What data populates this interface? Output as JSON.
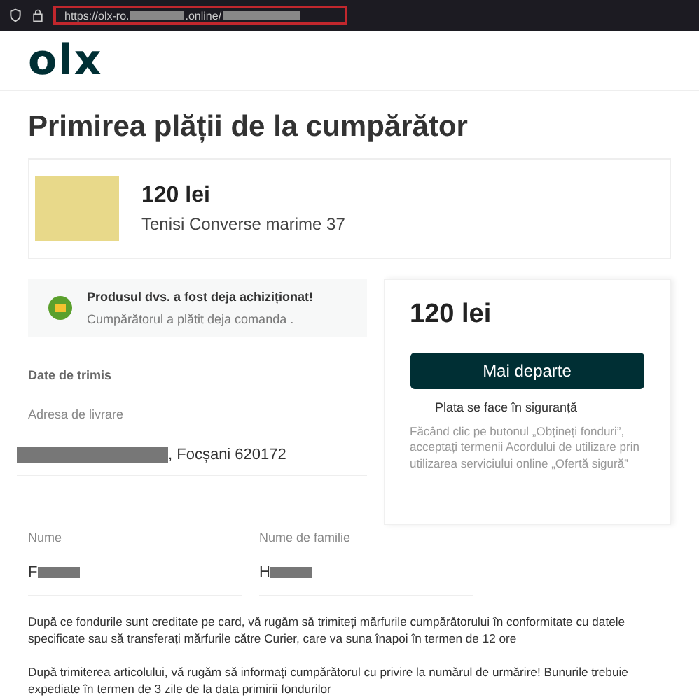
{
  "browser": {
    "url_start": "https://olx-ro.",
    "url_middle": ".online/"
  },
  "logo": "olx",
  "title": "Primirea plății de la cumpărător",
  "product": {
    "price": "120 lei",
    "name": "Tenisi Converse marime 37"
  },
  "notice": {
    "title": "Produsul dvs. a fost deja achiziționat!",
    "text": "Cumpărătorul a plătit deja comanda ."
  },
  "shipping": {
    "heading": "Date de trimis",
    "address_label": "Adresa de livrare",
    "address_value": ", Focșani 620172"
  },
  "names": [
    {
      "label": "Nume",
      "value": "F"
    },
    {
      "label": "Nume de familie",
      "value": "H"
    }
  ],
  "payment": {
    "price": "120 lei",
    "button": "Mai departe",
    "safe": "Plata se face în siguranță",
    "terms": "Făcând clic pe butonul „Obțineți fonduri”, acceptați termenii Acordului de utilizare prin utilizarea serviciului online „Ofertă sigură”"
  },
  "paragraphs": [
    "După ce fondurile sunt creditate pe card, vă rugăm să trimiteți mărfurile cumpărătorului în conformitate cu datele specificate sau să transferați mărfurile către Curier, care va suna înapoi în termen de 12 ore",
    "După trimiterea articolului, vă rugăm să informați cumpărătorul cu privire la numărul de urmărire! Bunurile trebuie expediate în termen de 3 zile de la data primirii fondurilor"
  ]
}
